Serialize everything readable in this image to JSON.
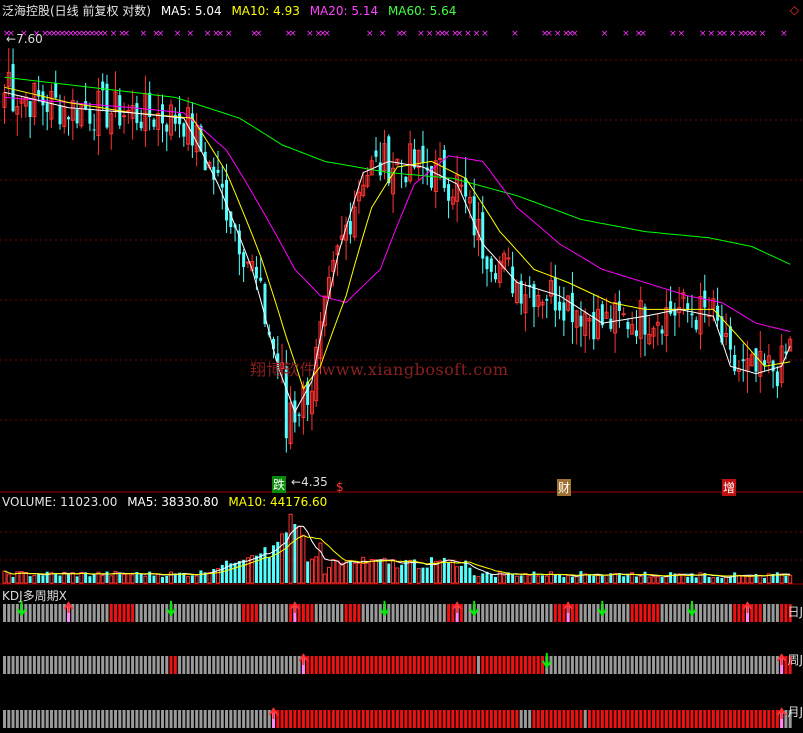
{
  "header": {
    "title": "泛海控股(日线 前复权 对数)",
    "ma5": "MA5: 5.04",
    "ma10": "MA10: 4.93",
    "ma20": "MA20: 5.14",
    "ma60": "MA60: 5.64"
  },
  "volume_header": {
    "volume": "VOLUME: 11023.00",
    "ma5": "MA5: 38330.80",
    "ma10": "MA10: 44176.60"
  },
  "kdj_header": "KDJ多周期X",
  "row_labels": {
    "daily": "日J",
    "weekly": "周J",
    "monthly": "月J"
  },
  "annotations": {
    "high": "7.60",
    "low": "4.35",
    "sig_die": "跌",
    "sig_s": "$",
    "sig_cai": "财",
    "sig_zeng": "增"
  },
  "watermark": "翔博软件 www.xiangbosoft.com",
  "colors": {
    "up": "#ff3232",
    "down": "#54ffff",
    "ma5": "#ffffff",
    "ma10": "#ffff00",
    "ma20": "#ff00ff",
    "ma60": "#00ff00",
    "grid": "#7a0000",
    "gray_bar": "#9a9a9a",
    "red_bar": "#ee1111"
  },
  "chart_data": {
    "type": "candlestick",
    "price_scale": "log",
    "ylim": [
      4.2,
      7.9
    ],
    "high": 7.6,
    "low": 4.35,
    "ma_anchors": {
      "ma5": [
        [
          0,
          7.15
        ],
        [
          15,
          7.0
        ],
        [
          30,
          6.95
        ],
        [
          42,
          6.9
        ],
        [
          50,
          6.3
        ],
        [
          58,
          5.6
        ],
        [
          64,
          4.9
        ],
        [
          68,
          4.6
        ],
        [
          72,
          4.8
        ],
        [
          78,
          5.7
        ],
        [
          84,
          6.4
        ],
        [
          90,
          6.5
        ],
        [
          98,
          6.45
        ],
        [
          106,
          6.3
        ],
        [
          112,
          5.8
        ],
        [
          120,
          5.5
        ],
        [
          130,
          5.4
        ],
        [
          140,
          5.2
        ],
        [
          150,
          5.25
        ],
        [
          158,
          5.3
        ],
        [
          166,
          5.25
        ],
        [
          170,
          4.9
        ],
        [
          176,
          4.85
        ],
        [
          182,
          4.9
        ],
        [
          184,
          5.04
        ]
      ],
      "ma10": [
        [
          0,
          7.2
        ],
        [
          15,
          7.05
        ],
        [
          30,
          6.95
        ],
        [
          44,
          6.9
        ],
        [
          52,
          6.4
        ],
        [
          60,
          5.7
        ],
        [
          66,
          5.1
        ],
        [
          70,
          4.75
        ],
        [
          74,
          4.9
        ],
        [
          80,
          5.4
        ],
        [
          86,
          6.1
        ],
        [
          92,
          6.45
        ],
        [
          100,
          6.5
        ],
        [
          108,
          6.35
        ],
        [
          116,
          5.9
        ],
        [
          124,
          5.6
        ],
        [
          132,
          5.5
        ],
        [
          142,
          5.35
        ],
        [
          150,
          5.3
        ],
        [
          158,
          5.3
        ],
        [
          166,
          5.3
        ],
        [
          172,
          5.1
        ],
        [
          178,
          4.9
        ],
        [
          184,
          4.93
        ]
      ],
      "ma20": [
        [
          0,
          7.1
        ],
        [
          15,
          7.05
        ],
        [
          30,
          7.0
        ],
        [
          42,
          6.95
        ],
        [
          52,
          6.6
        ],
        [
          60,
          6.1
        ],
        [
          68,
          5.6
        ],
        [
          74,
          5.4
        ],
        [
          80,
          5.35
        ],
        [
          88,
          5.6
        ],
        [
          96,
          6.3
        ],
        [
          104,
          6.55
        ],
        [
          112,
          6.5
        ],
        [
          120,
          6.1
        ],
        [
          130,
          5.8
        ],
        [
          140,
          5.6
        ],
        [
          150,
          5.5
        ],
        [
          160,
          5.4
        ],
        [
          168,
          5.35
        ],
        [
          176,
          5.2
        ],
        [
          184,
          5.14
        ]
      ],
      "ma60": [
        [
          0,
          7.3
        ],
        [
          20,
          7.2
        ],
        [
          40,
          7.1
        ],
        [
          55,
          6.9
        ],
        [
          65,
          6.65
        ],
        [
          75,
          6.5
        ],
        [
          90,
          6.4
        ],
        [
          105,
          6.35
        ],
        [
          120,
          6.2
        ],
        [
          135,
          6.0
        ],
        [
          150,
          5.9
        ],
        [
          165,
          5.85
        ],
        [
          175,
          5.78
        ],
        [
          184,
          5.64
        ]
      ]
    },
    "kdj_rows": [
      "日J",
      "周J",
      "月J"
    ]
  }
}
